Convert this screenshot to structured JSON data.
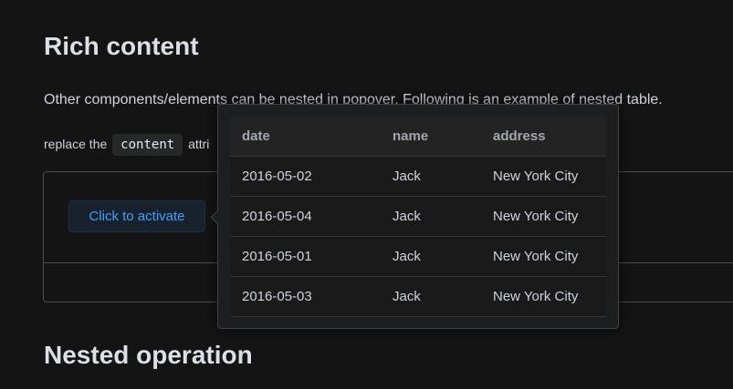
{
  "sections": {
    "rich_title": "Rich content",
    "rich_desc": "Other components/elements can be nested in popover. Following is an example of nested table.",
    "replace_prefix": "replace the",
    "replace_code": "content",
    "replace_suffix": "attri",
    "nested_title": "Nested operation"
  },
  "demo": {
    "activate_label": "Click to activate"
  },
  "popover": {
    "columns": [
      "date",
      "name",
      "address"
    ],
    "rows": [
      [
        "2016-05-02",
        "Jack",
        "New York City"
      ],
      [
        "2016-05-04",
        "Jack",
        "New York City"
      ],
      [
        "2016-05-01",
        "Jack",
        "New York City"
      ],
      [
        "2016-05-03",
        "Jack",
        "New York City"
      ]
    ]
  },
  "colors": {
    "background": "#141414",
    "primary": "#409eff",
    "border": "#4c4d4f"
  }
}
